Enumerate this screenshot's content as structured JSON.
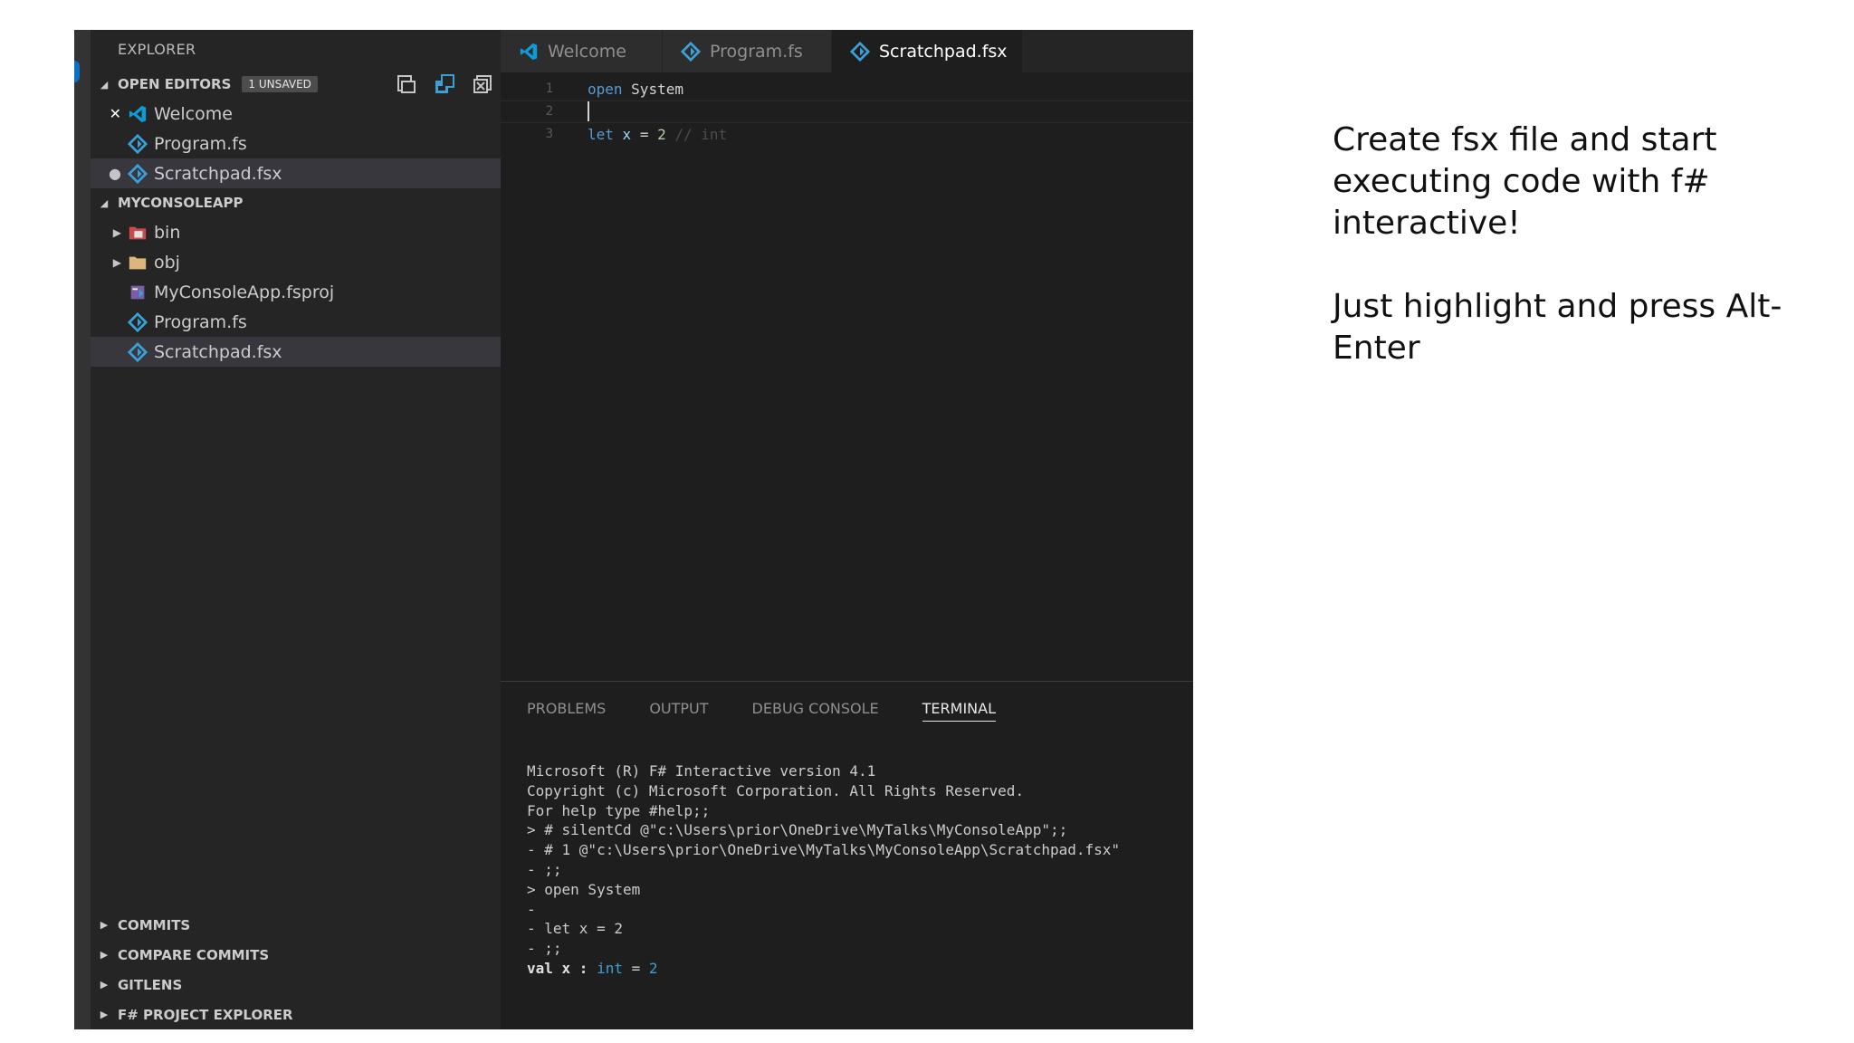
{
  "sidebar": {
    "title": "EXPLORER",
    "open_editors": {
      "label": "OPEN EDITORS",
      "badge": "1 UNSAVED",
      "items": [
        {
          "label": "Welcome",
          "lead": "✕",
          "icon": "vscode-icon"
        },
        {
          "label": "Program.fs",
          "lead": "",
          "icon": "fsharp-icon"
        },
        {
          "label": "Scratchpad.fsx",
          "lead": "●",
          "icon": "fsharp-icon"
        }
      ]
    },
    "project": {
      "label": "MYCONSOLEAPP",
      "items": [
        {
          "label": "bin",
          "lead": "▶",
          "icon": "folder-bin-icon"
        },
        {
          "label": "obj",
          "lead": "▶",
          "icon": "folder-icon"
        },
        {
          "label": "MyConsoleApp.fsproj",
          "lead": "",
          "icon": "fsproj-icon"
        },
        {
          "label": "Program.fs",
          "lead": "",
          "icon": "fsharp-icon"
        },
        {
          "label": "Scratchpad.fsx",
          "lead": "",
          "icon": "fsharp-icon"
        }
      ]
    },
    "bottom_sections": [
      "COMMITS",
      "COMPARE COMMITS",
      "GITLENS",
      "F# PROJECT EXPLORER"
    ]
  },
  "tabs": [
    {
      "label": "Welcome",
      "icon": "vscode-icon"
    },
    {
      "label": "Program.fs",
      "icon": "fsharp-icon"
    },
    {
      "label": "Scratchpad.fsx",
      "icon": "fsharp-icon",
      "dirty": true
    }
  ],
  "code": {
    "line_numbers": [
      "1",
      "2",
      "3"
    ],
    "line1": {
      "kw": "open",
      "id": "System"
    },
    "line3": {
      "kw": "let",
      "var": "x",
      "eq": "=",
      "num": "2",
      "comment": "// int"
    }
  },
  "panel": {
    "tabs": [
      "PROBLEMS",
      "OUTPUT",
      "DEBUG CONSOLE",
      "TERMINAL"
    ],
    "active_tab": "TERMINAL",
    "terminal_lines": [
      "Microsoft (R) F# Interactive version 4.1",
      "Copyright (c) Microsoft Corporation. All Rights Reserved.",
      "",
      "For help type #help;;",
      "",
      "> # silentCd @\"c:\\Users\\prior\\OneDrive\\MyTalks\\MyConsoleApp\";;",
      "- # 1 @\"c:\\Users\\prior\\OneDrive\\MyTalks\\MyConsoleApp\\Scratchpad.fsx\"",
      "- ;;",
      "> open System",
      "-",
      "- let x = 2",
      "- ;;"
    ],
    "result": {
      "prefix": "val x : ",
      "type": "int",
      "eq": " = ",
      "value": "2"
    }
  },
  "note": {
    "line1": "Create fsx file and start executing code with f# interactive!",
    "line2": "Just highlight and press Alt-Enter"
  },
  "colors": {
    "accent": "#0e70c0",
    "fsharp": "#3aa0d5",
    "keyword": "#569cd6"
  }
}
